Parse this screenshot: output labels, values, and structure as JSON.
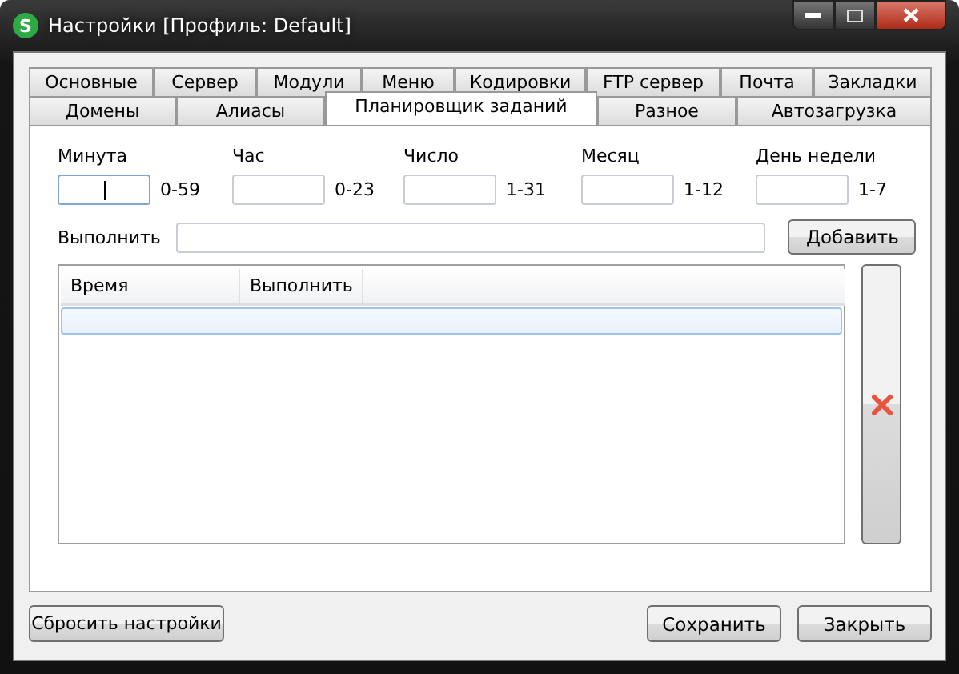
{
  "window": {
    "icon_letter": "S",
    "title": "Настройки [Профиль: Default]"
  },
  "tab_rows": [
    [
      {
        "label": "Основные",
        "selected": false
      },
      {
        "label": "Сервер",
        "selected": false
      },
      {
        "label": "Модули",
        "selected": false
      },
      {
        "label": "Меню",
        "selected": false
      },
      {
        "label": "Кодировки",
        "selected": false
      },
      {
        "label": "FTP сервер",
        "selected": false
      },
      {
        "label": "Почта",
        "selected": false
      },
      {
        "label": "Закладки",
        "selected": false
      }
    ],
    [
      {
        "label": "Домены",
        "selected": false
      },
      {
        "label": "Алиасы",
        "selected": false
      },
      {
        "label": "Планировщик заданий",
        "selected": true
      },
      {
        "label": "Разное",
        "selected": false
      },
      {
        "label": "Автозагрузка",
        "selected": false
      }
    ]
  ],
  "schedule_fields": [
    {
      "label": "Минута",
      "range": "0-59",
      "focused": true
    },
    {
      "label": "Час",
      "range": "0-23",
      "focused": false
    },
    {
      "label": "Число",
      "range": "1-31",
      "focused": false
    },
    {
      "label": "Месяц",
      "range": "1-12",
      "focused": false
    },
    {
      "label": "День недели",
      "range": "1-7",
      "focused": false
    }
  ],
  "command": {
    "label": "Выполнить",
    "add_button": "Добавить"
  },
  "table": {
    "columns": [
      "Время",
      "Выполнить"
    ],
    "rows": [
      {
        "selected": true
      }
    ]
  },
  "buttons": {
    "reset": "Сбросить настройки",
    "save": "Сохранить",
    "close": "Закрыть"
  }
}
